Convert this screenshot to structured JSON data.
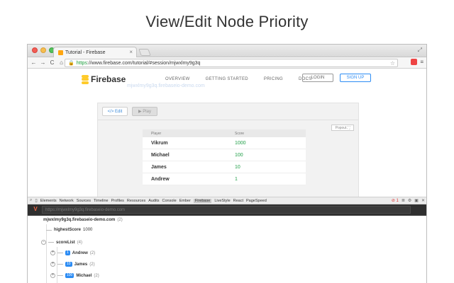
{
  "banner": {
    "title": "View/Edit Node Priority"
  },
  "browser": {
    "tab_title": "Tutorial - Firebase",
    "tab_close": "×",
    "url_https": "https",
    "url_rest": "://www.firebase.com/tutorial/#session/mjwxlmy9g3q",
    "nav": {
      "back": "←",
      "forward": "→",
      "reload": "C",
      "home": "⌂"
    },
    "menu": "≡",
    "resize": "⤢"
  },
  "site": {
    "logo_text": "Firebase",
    "links": [
      "OVERVIEW",
      "GETTING STARTED",
      "PRICING",
      "DOCS"
    ],
    "login": "LOGIN",
    "signup": "SIGN UP",
    "ghost_line": "mjwxlmy9g3q.firebaseio-demo.com"
  },
  "panel": {
    "edit": "</> Edit",
    "play": "▶ Play",
    "popout": "Popout ⛶",
    "table": {
      "headers": [
        "Player",
        "Score"
      ],
      "rows": [
        {
          "player": "Vikrum",
          "score": "1000"
        },
        {
          "player": "Michael",
          "score": "100"
        },
        {
          "player": "James",
          "score": "10"
        },
        {
          "player": "Andrew",
          "score": "1"
        }
      ]
    }
  },
  "devtools": {
    "tabs": [
      "Elements",
      "Network",
      "Sources",
      "Timeline",
      "Profiles",
      "Resources",
      "Audits",
      "Console",
      "Ember",
      "Firebase",
      "LiveStyle",
      "React",
      "PageSpeed"
    ],
    "active_tab": "Firebase",
    "error_count": "1"
  },
  "firebase_panel": {
    "url_placeholder": "https://mjwxlmy9g3q.firebaseio-demo.com",
    "root": {
      "name": "mjwxlmy9g3q.firebaseio-demo.com",
      "count": "(2)"
    },
    "highest": {
      "name": "highestScore",
      "value": "1000"
    },
    "scoreList": {
      "name": "scoreList",
      "count": "(4)"
    },
    "children": [
      {
        "priority": "1",
        "name": "Andrew",
        "count": "(2)"
      },
      {
        "priority": "10",
        "name": "James",
        "count": "(2)"
      },
      {
        "priority": "100",
        "name": "Michael",
        "count": "(2)"
      }
    ]
  }
}
